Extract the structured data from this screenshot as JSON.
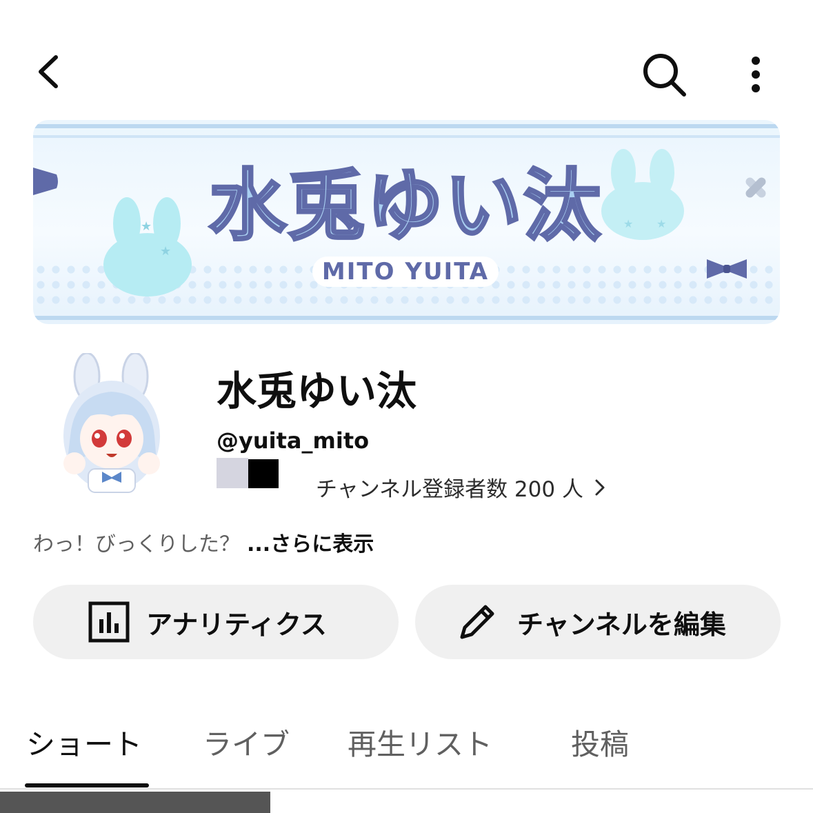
{
  "topbar": {
    "back_icon": "chevron-left-icon",
    "search_icon": "search-icon",
    "more_icon": "more-vert-icon"
  },
  "banner": {
    "logo_text": "水兎ゆい汰",
    "logo_sub": "MITO YUITA",
    "accent": "#5f6aa8",
    "fill": "#a9cff1"
  },
  "channel": {
    "name": "水兎ゆい汰",
    "handle": "@yuita_mito",
    "subscribers": "チャンネル登録者数 200 人",
    "description": "わっ！びっくりした？",
    "more_label": "...さらに表示"
  },
  "actions": {
    "analytics_label": "アナリティクス",
    "edit_label": "チャンネルを編集"
  },
  "tabs": [
    {
      "label": "ショート",
      "active": true
    },
    {
      "label": "ライブ",
      "active": false
    },
    {
      "label": "再生リスト",
      "active": false
    },
    {
      "label": "投稿",
      "active": false
    }
  ]
}
